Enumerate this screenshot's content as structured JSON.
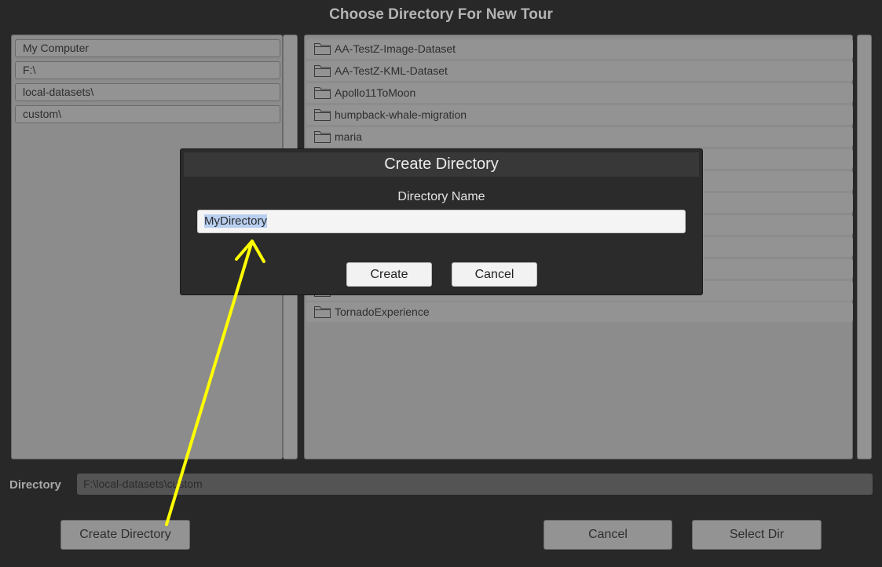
{
  "window": {
    "title": "Choose Directory For New Tour"
  },
  "breadcrumbs": [
    {
      "label": "My Computer"
    },
    {
      "label": "F:\\"
    },
    {
      "label": "local-datasets\\"
    },
    {
      "label": "custom\\"
    }
  ],
  "folders": [
    {
      "name": "AA-TestZ-Image-Dataset"
    },
    {
      "name": "AA-TestZ-KML-Dataset"
    },
    {
      "name": "Apollo11ToMoon"
    },
    {
      "name": "humpback-whale-migration"
    },
    {
      "name": "maria"
    },
    {
      "name": ""
    },
    {
      "name": ""
    },
    {
      "name": ""
    },
    {
      "name": ""
    },
    {
      "name": ""
    },
    {
      "name": ""
    },
    {
      "name": ""
    },
    {
      "name": "TornadoExperience"
    }
  ],
  "directory": {
    "label": "Directory",
    "value": "F:\\local-datasets\\custom"
  },
  "buttons": {
    "create_directory": "Create Directory",
    "cancel": "Cancel",
    "select_dir": "Select Dir"
  },
  "dialog": {
    "title": "Create Directory",
    "field_label": "Directory Name",
    "field_value": "MyDirectory",
    "create": "Create",
    "cancel": "Cancel"
  },
  "annotation": {
    "color": "#ffff00",
    "icon": "arrow-annotation"
  }
}
